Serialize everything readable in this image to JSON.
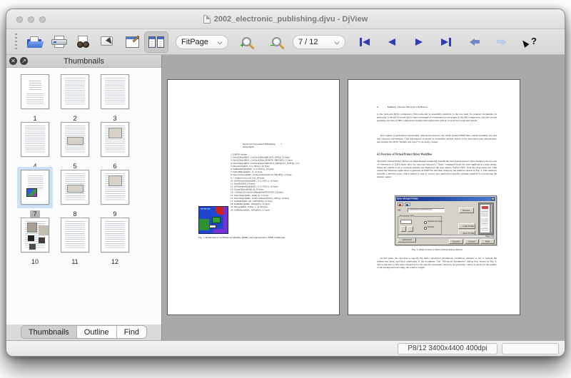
{
  "window": {
    "title": "2002_electronic_publishing.djvu - DjView"
  },
  "toolbar": {
    "icons": [
      "open-icon",
      "print-icon",
      "find-icon",
      "select-icon",
      "edit-annotate-icon",
      "sidebar-toggle-icon",
      "zoom-in-icon",
      "zoom-out-icon",
      "first-page-icon",
      "previous-page-icon",
      "next-page-icon",
      "last-page-icon",
      "back-icon",
      "forward-icon",
      "context-help-icon"
    ],
    "zoom_mode_value": "FitPage",
    "page_value": "7 / 12"
  },
  "sidebar": {
    "title": "Thumbnails",
    "close_glyph": "✕",
    "float_glyph": "↗",
    "pages": [
      {
        "num": "1",
        "variant": "title",
        "selected": false
      },
      {
        "num": "2",
        "variant": "text",
        "selected": false
      },
      {
        "num": "3",
        "variant": "text",
        "selected": false
      },
      {
        "num": "4",
        "variant": "text",
        "selected": false
      },
      {
        "num": "5",
        "variant": "figmid",
        "selected": false
      },
      {
        "num": "6",
        "variant": "figtop",
        "selected": false
      },
      {
        "num": "7",
        "variant": "emf",
        "selected": true
      },
      {
        "num": "8",
        "variant": "figmid",
        "selected": false
      },
      {
        "num": "9",
        "variant": "figtop",
        "selected": false
      },
      {
        "num": "10",
        "variant": "dark",
        "selected": false
      },
      {
        "num": "11",
        "variant": "text",
        "selected": false
      },
      {
        "num": "12",
        "variant": "text",
        "selected": false
      }
    ],
    "tabs": [
      {
        "label": "Thumbnails"
      },
      {
        "label": "Outline"
      },
      {
        "label": "Find"
      }
    ]
  },
  "document": {
    "left_page": {
      "running_head": "Electronic Document Publishing using DjVu",
      "page_number": "7",
      "emf_list": "1: EMFR+ header\n2: SelectObject(hDC, GetStockObject(BLACK_PEN)), 12 bytes\n3: SelectObject(hDC, GetStockObject(WHITE_BRUSH)), 12 bytes\n4: SelectObject(hDC, GetStockObject(DEVICE_DEFAULT_FONT)), 12 b\n5: MoveToEx(hDC, 0, 0, NULL), 16 bytes\n6: SetBrushOrgEx(hDC, 0, 0, NULL), 16 bytes\n7: SetICMMode(hDC, 1), 12 bytes\n8: SetColorSpace(hDC, GetStockObject(0x14 (\"sRGB\")), 12 bytes\n9: // Unknown record [114], 28 bytes\n10: SetViewportOrgEx(hDC, 0, 0, NULL), 16 bytes\n11: SaveDC(hDC), 8 bytes\n12: SetViewportOrgEx(hDC, 0, 0, NULL), 16 bytes\n13: CreateObject(hObj[1]), 64 bytes\n14: // hObj[1]=CreateSolidBrush(0x00FFFFFF), 24 bytes\n15: SelectObject(hDC, hObj[1]), 12 bytes\n16: SelectObject(hDC, GetStockObject(NULL_PEN)), 12 bytes\n17: SetROP2(hDC, R2_COPYPEN), 12 bytes\n18: SetBkMode(hDC, OPAQUE), 12 bytes\n19: Polygon(hDC, Points_1, 4), 44 bytes\n20: SetBkMode(hDC, OPAQUE), 12 bytes",
      "emf_image_label": "DEAR SIR!",
      "caption": "Fig. 1. Rendering of an Enhanced Metafile (EMF) and representative EMF commands."
    },
    "right_page": {
      "page_number": "8",
      "running_head": "Mikheev, Vincent, Hawrylycz & Bottou",
      "para1": "to the back-end DjVu compressor. This back-end is essentially identical to the one used for scanned documents. In particular, it should be noted that it takes advantage of redundancy across pages in the JB2 compressor, and also avoids spending any bits on JB2-compressed background regions that will be covered by foreground pixels.",
      "para2": "Text capture is performed concurrently, without the need for any OCR. Indeed, EMF files contain bounding box and text character information. This information is parsed as essentially another object of the structured page information, and enables the DjVu “hidden text layer” to be easily created.",
      "heading": "4.3   Overview of Virtual Printer Driver Workflow",
      "para3": "The DjVu Virtual Printer Driver we implemented seamlessly installs the new system printer. Once installed, the process of conversion to DjVu starts after the user has selected a “Print” command from the host application’s print menu. When the visible local or network printers are displayed, the user selects “DjVu VPD” from the drop-down list. This causes the Windows application to generate an EMF file and then brings up the interface shown in Fig. 2. This interface includes a preview pane, which makes it easy to correct any application-specific settings required for producing the desired output.",
      "fig_caption": "Fig. 2. Main Screen of DjVu Virtual Printer Driver",
      "para4": "At this point, the user has to specify the main conversion parameters: resolution, whether or not to include the hidden text layer, and final orientation of the document. The “Advanced Parameters” dialog box, shown in Fig. 3, allows the user to fine tune conversion for the specific document variation. In particular, control is given for the quality of the background encoding, the relative weight",
      "dialog": {
        "title": "DjVu Virtual Printer",
        "file_label": "File",
        "file_value": "C:\\temp\\djvu-converter.djvu",
        "browse": "Browse",
        "group_label": "Resolution DPI",
        "radio1": "Include text layer",
        "radio2": "Portrait",
        "advanced": "Advanced",
        "load_profile": "Load Profile",
        "save_profile": "Save Profile",
        "page_strip": "Page 1/1",
        "convert": "Convert",
        "cancel": "Cancel",
        "help": "Help"
      }
    }
  },
  "statusbar": {
    "page_info": "P8/12 3400x4400 400dpi"
  }
}
